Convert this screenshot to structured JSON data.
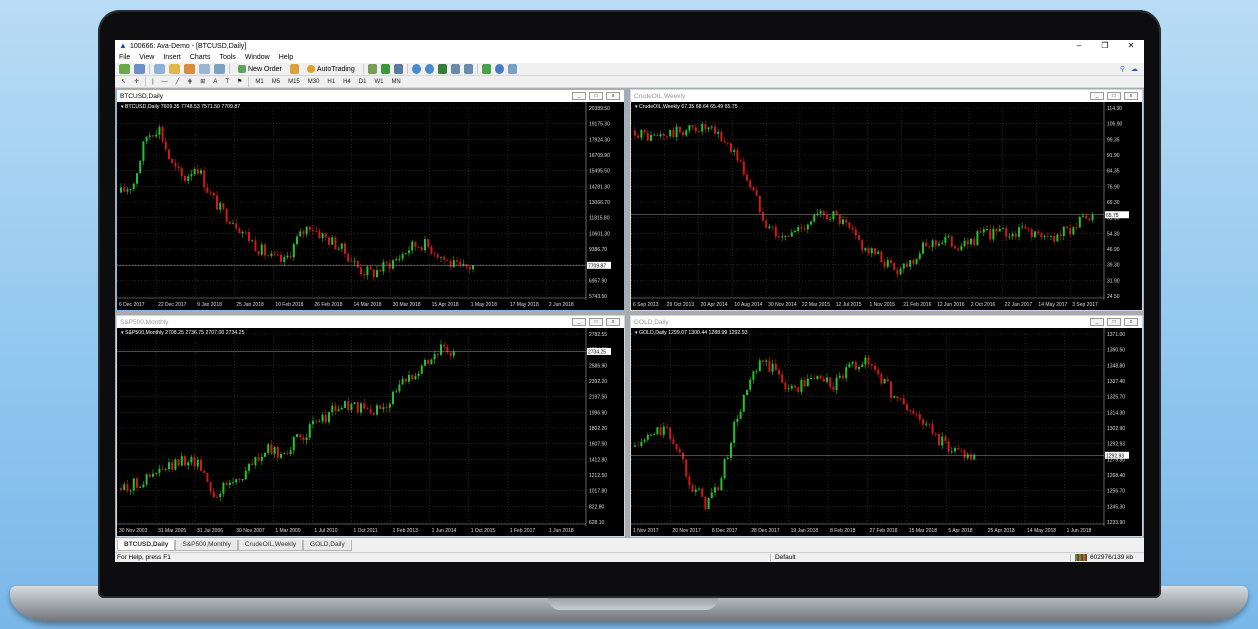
{
  "app": {
    "title": "100666: Ava-Demo - [BTCUSD,Daily]",
    "window_controls": [
      "–",
      "❐",
      "✕"
    ]
  },
  "menu": [
    "File",
    "View",
    "Insert",
    "Charts",
    "Tools",
    "Window",
    "Help"
  ],
  "toolbar": {
    "new_order_label": "New Order",
    "autotrading_label": "AutoTrading",
    "timeframes": [
      "M1",
      "M5",
      "M15",
      "M30",
      "H1",
      "H4",
      "D1",
      "W1",
      "MN"
    ],
    "draw_tools": [
      "↖",
      "✛",
      "|",
      "—",
      "╱",
      "⋕",
      "⊞",
      "A",
      "T",
      "⚑"
    ]
  },
  "charts": [
    {
      "window_title": "BTCUSD,Daily",
      "info_line": "BTCUSD,Daily  7609.35 7748.53 7571.50 7709.87",
      "price_labels": [
        "20389.50",
        "19175.30",
        "17924.30",
        "16709.90",
        "15495.50",
        "14281.30",
        "13066.70",
        "11815.80",
        "10601.30",
        "9386.70",
        "8172.30",
        "6957.90",
        "5743.50"
      ],
      "current_price": "7709.87",
      "date_labels": [
        "6 Dec 2017",
        "22 Dec 2017",
        "9 Jan 2018",
        "25 Jan 2018",
        "10 Feb 2018",
        "26 Feb 2018",
        "14 Mar 2018",
        "30 Mar 2018",
        "15 Apr 2018",
        "1 May 2018",
        "17 May 2018",
        "2 Jun 2018"
      ],
      "active": true
    },
    {
      "window_title": "CrudeOIL,Weekly",
      "info_line": "CrudeOIL,Weekly  67.35 68.64 65.49 65.75",
      "price_labels": [
        "114.30",
        "106.90",
        "99.35",
        "91.90",
        "84.35",
        "76.90",
        "69.30",
        "61.90",
        "54.30",
        "46.90",
        "39.30",
        "31.90",
        "24.50"
      ],
      "current_price": "65.75",
      "date_labels": [
        "6 Sep 2013",
        "29 Oct 2013",
        "20 Apr 2014",
        "10 Aug 2014",
        "30 Nov 2014",
        "22 Mar 2015",
        "12 Jul 2015",
        "1 Nov 2015",
        "21 Feb 2016",
        "12 Jun 2016",
        "2 Oct 2016",
        "22 Jan 2017",
        "14 May 2017",
        "3 Sep 2017"
      ],
      "active": false
    },
    {
      "window_title": "S&P500,Monthly",
      "info_line": "S&P500,Monthly  2708.25 2736.75 2707.00 2734.25",
      "price_labels": [
        "2782.55",
        "2734.25",
        "2586.90",
        "2392.20",
        "2197.50",
        "1996.90",
        "1802.20",
        "1607.50",
        "1412.80",
        "1212.50",
        "1017.80",
        "822.80",
        "628.10"
      ],
      "current_price": "2734.25",
      "date_labels": [
        "30 Nov 2003",
        "31 Mar 2005",
        "31 Jul 2006",
        "30 Nov 2007",
        "1 Mar 2009",
        "1 Jul 2010",
        "1 Oct 2011",
        "1 Feb 2013",
        "1 Jun 2014",
        "1 Oct 2015",
        "1 Feb 2017",
        "1 Jun 2018"
      ],
      "active": false
    },
    {
      "window_title": "GOLD,Daily",
      "info_line": "GOLD,Daily  1299.07 1300.44 1288.99 1292.93",
      "price_labels": [
        "1371.00",
        "1360.50",
        "1348.80",
        "1337.40",
        "1325.70",
        "1314.30",
        "1302.90",
        "1292.93",
        "1279.80",
        "1268.40",
        "1256.70",
        "1245.30",
        "1233.90"
      ],
      "current_price": "1292.93",
      "date_labels": [
        "1 Nov 2017",
        "20 Nov 2017",
        "8 Dec 2017",
        "28 Dec 2017",
        "19 Jan 2018",
        "8 Feb 2018",
        "27 Feb 2018",
        "15 Mar 2018",
        "5 Apr 2018",
        "25 Apr 2018",
        "14 May 2018",
        "1 Jun 2018"
      ],
      "active": false
    }
  ],
  "tabs": [
    "BTCUSD,Daily",
    "S&P500,Monthly",
    "CrudeOIL,Weekly",
    "GOLD,Daily"
  ],
  "status": {
    "help": "For Help, press F1",
    "profile": "Default",
    "traffic": "602976/139 kb"
  },
  "colors": {
    "bull": "#22c42a",
    "bear": "#d21818",
    "grid": "#3a3a3a",
    "active_border": "#8ab4e6"
  }
}
